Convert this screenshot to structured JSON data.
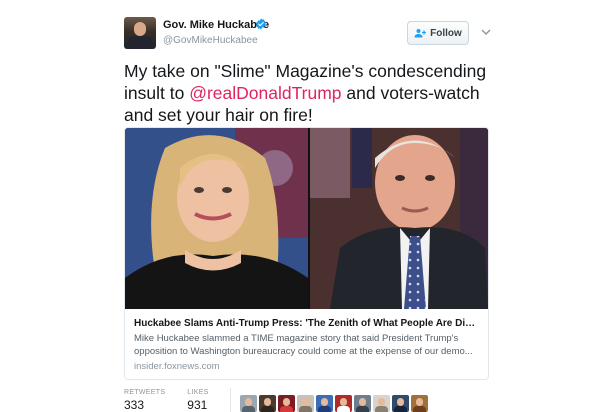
{
  "author": {
    "name": "Gov. Mike Huckabee",
    "handle": "@GovMikeHuckabee",
    "verified": true
  },
  "follow_button": {
    "label": "Follow",
    "icon": "add-person-icon"
  },
  "more_menu": {
    "icon": "chevron-down-icon"
  },
  "tweet": {
    "text_before": "My take on \"Slime\" Magazine's condescending insult to ",
    "mention": "@realDonaldTrump",
    "text_after": " and voters-watch and set your hair on fire!"
  },
  "card": {
    "title": "Huckabee Slams Anti-Trump Press: 'The Zenith of What People Are Disgust...",
    "description": "Mike Huckabee slammed a TIME magazine story that said President Trump's opposition to Washington bureaucracy could come at the expense of our demo...",
    "domain": "insider.foxnews.com"
  },
  "stats": {
    "retweets_label": "RETWEETS",
    "retweets_count": "333",
    "likes_label": "LIKES",
    "likes_count": "931"
  },
  "colors": {
    "mention": "#e0245e",
    "verified": "#1da1f2",
    "stat_value": "#14171a"
  },
  "liker_avatars": [
    {
      "icon": "avatar-icon",
      "bg": "#9aa7b1",
      "body": "#566470"
    },
    {
      "icon": "avatar-icon",
      "bg": "#4c3a2e",
      "body": "#2d2520"
    },
    {
      "icon": "avatar-icon",
      "bg": "#7b1d24",
      "body": "#d23a3a"
    },
    {
      "icon": "avatar-icon",
      "bg": "#c9c2b8",
      "body": "#7f7569"
    },
    {
      "icon": "avatar-icon",
      "bg": "#3d6db5",
      "body": "#1f3d7a"
    },
    {
      "icon": "avatar-icon",
      "bg": "#b02a2a",
      "body": "#ffffff"
    },
    {
      "icon": "avatar-icon",
      "bg": "#6c7e8e",
      "body": "#34414d"
    },
    {
      "icon": "avatar-icon",
      "bg": "#d8d3cc",
      "body": "#8c8072"
    },
    {
      "icon": "avatar-icon",
      "bg": "#2f4a6b",
      "body": "#14243a"
    },
    {
      "icon": "avatar-icon",
      "bg": "#a3703c",
      "body": "#6b3f1c"
    }
  ]
}
